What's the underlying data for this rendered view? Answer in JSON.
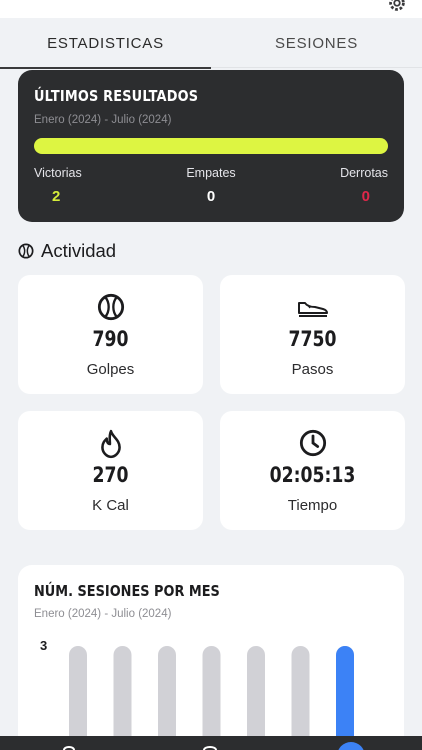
{
  "tabs": [
    {
      "label": "ESTADISTICAS",
      "active": true
    },
    {
      "label": "SESIONES",
      "active": false
    }
  ],
  "results": {
    "title": "ÚLTIMOS RESULTADOS",
    "period": "Enero (2024) - Julio (2024)",
    "bar_color": "#ddf542",
    "win_fraction": 1,
    "stats": [
      {
        "label": "Victorias",
        "value": "2",
        "color": "#d5ec3a"
      },
      {
        "label": "Empates",
        "value": "0",
        "color": "#ffffff"
      },
      {
        "label": "Derrotas",
        "value": "0",
        "color": "#e0274a"
      }
    ]
  },
  "activity": {
    "title": "Actividad",
    "icon": "tennis-ball-icon",
    "tiles": [
      {
        "icon": "tennis-ball-icon",
        "value": "790",
        "label": "Golpes"
      },
      {
        "icon": "sneaker-icon",
        "value": "7750",
        "label": "Pasos"
      },
      {
        "icon": "flame-icon",
        "value": "270",
        "label": "K Cal"
      },
      {
        "icon": "clock-icon",
        "value": "02:05:13",
        "label": "Tiempo"
      }
    ]
  },
  "sessions": {
    "title": "NÚM. SESIONES POR MES",
    "period": "Enero (2024) - Julio (2024)",
    "y_tick": "3"
  },
  "chart_data": {
    "type": "bar",
    "title": "NÚM. SESIONES POR MES",
    "subtitle": "Enero (2024) - Julio (2024)",
    "categories": [],
    "values": [
      0,
      0,
      0,
      0,
      0,
      0,
      3
    ],
    "ylim": [
      0,
      3
    ],
    "y_ticks": [
      "3"
    ],
    "track_color": "#d1d1d6",
    "highlight_color": "#3c82f6",
    "grid": false
  },
  "colors": {
    "dark_card": "#2c2d2f",
    "background": "#f0f2f5",
    "accent_blue": "#3c82f6"
  }
}
